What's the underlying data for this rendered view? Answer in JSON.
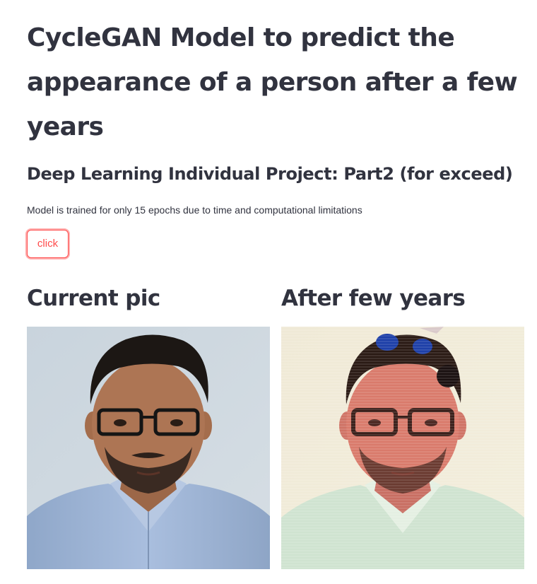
{
  "page": {
    "title": "CycleGAN Model to predict the appearance of a person after a few years",
    "subtitle": "Deep Learning Individual Project: Part2 (for exceed)",
    "note": "Model is trained for only 15 epochs due to time and computational limitations",
    "button_label": "click"
  },
  "columns": [
    {
      "heading": "Current pic",
      "image": "portrait-current"
    },
    {
      "heading": "After few years",
      "image": "portrait-generated"
    }
  ],
  "colors": {
    "text": "#31333f",
    "accent": "#ff4b4b",
    "background": "#ffffff"
  }
}
